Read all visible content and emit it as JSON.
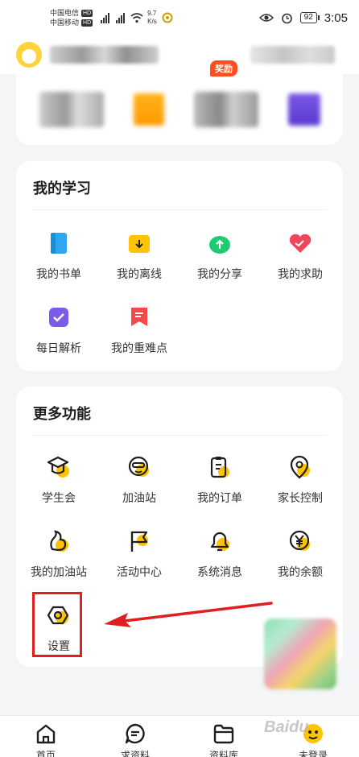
{
  "status_bar": {
    "carrier1": "中国电信",
    "carrier2": "中国移动",
    "hd": "HD",
    "network1": "4G",
    "network2": "4G",
    "speed_value": "9.7",
    "speed_unit": "K/s",
    "battery": "92",
    "time": "3:05"
  },
  "study": {
    "title": "我的学习",
    "items": [
      {
        "label": "我的书单",
        "icon": "book-icon"
      },
      {
        "label": "我的离线",
        "icon": "offline-download-icon"
      },
      {
        "label": "我的分享",
        "icon": "share-icon"
      },
      {
        "label": "我的求助",
        "icon": "heart-help-icon"
      },
      {
        "label": "每日解析",
        "icon": "daily-check-icon"
      },
      {
        "label": "我的重难点",
        "icon": "bookmark-note-icon"
      }
    ],
    "badge": "奖励"
  },
  "more": {
    "title": "更多功能",
    "items": [
      {
        "label": "学生会",
        "icon": "graduation-cap-icon"
      },
      {
        "label": "加油站",
        "icon": "face-icon"
      },
      {
        "label": "我的订单",
        "icon": "order-clipboard-icon"
      },
      {
        "label": "家长控制",
        "icon": "parent-control-icon"
      },
      {
        "label": "我的加油站",
        "icon": "gesture-icon"
      },
      {
        "label": "活动中心",
        "icon": "flag-icon"
      },
      {
        "label": "系统消息",
        "icon": "bell-icon"
      },
      {
        "label": "我的余额",
        "icon": "yen-coin-icon"
      },
      {
        "label": "设置",
        "icon": "settings-hex-icon"
      }
    ]
  },
  "bottom_nav": [
    {
      "label": "首页",
      "icon": "home-icon"
    },
    {
      "label": "求资料",
      "icon": "chat-icon"
    },
    {
      "label": "资料库",
      "icon": "folder-icon"
    },
    {
      "label": "未登录",
      "icon": "profile-icon"
    }
  ],
  "watermark": "Baidu",
  "colors": {
    "accent": "#ffc400",
    "badge": "#ff4e1f",
    "highlight": "#e02020",
    "book": "#2fa7ee",
    "share": "#1fcb72",
    "help": "#f0455a",
    "daily": "#7b5ce8",
    "note": "#f04a4a"
  }
}
